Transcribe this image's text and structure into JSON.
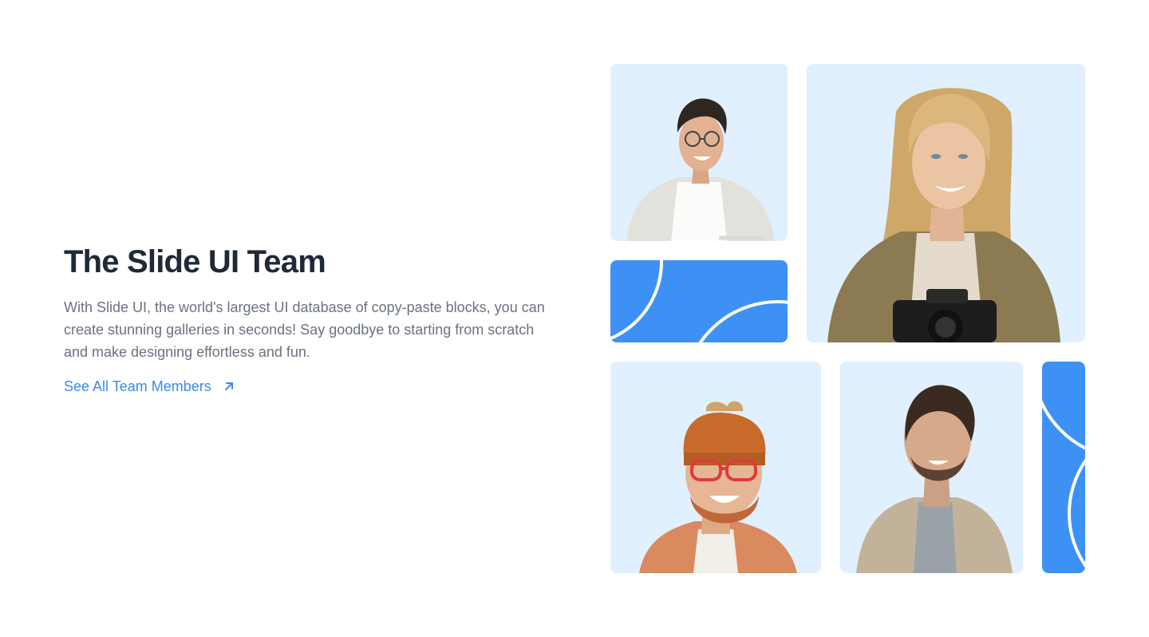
{
  "section": {
    "title": "The Slide UI Team",
    "description": "With Slide UI, the world's largest UI database of copy-paste blocks, you can create stunning galleries in seconds! Say goodbye to starting from scratch and make designing effortless and fun.",
    "link_label": "See All Team Members",
    "link_icon": "arrow-up-right-icon"
  },
  "colors": {
    "accent": "#3b8be6",
    "photo_bg": "#e0f0fe",
    "decor_blue": "#3d91f5",
    "heading": "#1f2937",
    "body_text": "#6b7280"
  },
  "gallery": {
    "members": [
      {
        "description": "man with glasses, white shirt and light cardigan"
      },
      {
        "description": "blonde woman in olive jacket holding a camera"
      },
      {
        "description": "bearded man with orange beanie and red glasses, laughing"
      },
      {
        "description": "man with beard in beige jacket and grey polo"
      }
    ]
  }
}
